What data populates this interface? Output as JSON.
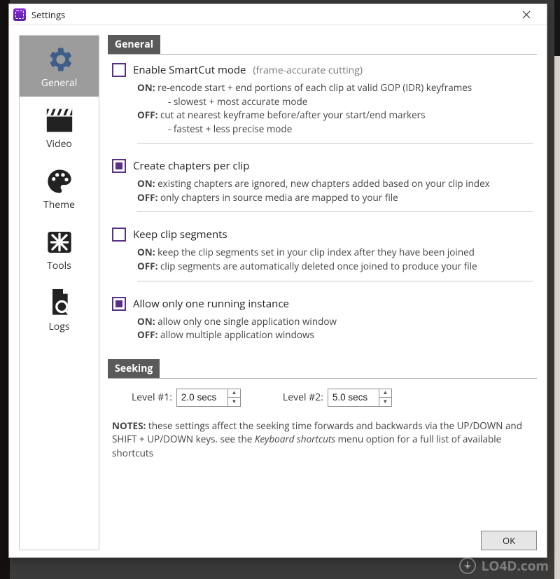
{
  "window": {
    "title": "Settings"
  },
  "sidebar": {
    "items": [
      {
        "label": "General"
      },
      {
        "label": "Video"
      },
      {
        "label": "Theme"
      },
      {
        "label": "Tools"
      },
      {
        "label": "Logs"
      }
    ]
  },
  "sections": {
    "general": {
      "header": "General",
      "options": {
        "smartcut": {
          "checked": false,
          "label": "Enable SmartCut mode",
          "paren": "(frame-accurate cutting)",
          "on_prefix": "ON:",
          "on_text": "re-encode start + end portions of each clip at valid GOP (IDR) keyframes",
          "on_sub": "- slowest + most accurate mode",
          "off_prefix": "OFF:",
          "off_text": "cut at nearest keyframe before/after your start/end markers",
          "off_sub": "- fastest + less precise mode"
        },
        "chapters": {
          "checked": true,
          "label": "Create chapters per clip",
          "on_prefix": "ON:",
          "on_text": "existing chapters are ignored, new chapters added based on your clip index",
          "off_prefix": "OFF:",
          "off_text": "only chapters in source media are mapped to your file"
        },
        "keep_segments": {
          "checked": false,
          "label": "Keep clip segments",
          "on_prefix": "ON:",
          "on_text": "keep the clip segments set in your clip index after they have been joined",
          "off_prefix": "OFF:",
          "off_text": "clip segments are automatically deleted once joined to produce your file"
        },
        "single_instance": {
          "checked": true,
          "label": "Allow only one running instance",
          "on_prefix": "ON:",
          "on_text": "allow only one single application window",
          "off_prefix": "OFF:",
          "off_text": "allow multiple application windows"
        }
      }
    },
    "seeking": {
      "header": "Seeking",
      "level1_label": "Level #1:",
      "level1_value": "2.0 secs",
      "level2_label": "Level #2:",
      "level2_value": "5.0 secs",
      "notes_prefix": "NOTES:",
      "notes_part1": "these settings affect the seeking time forwards and backwards via the UP/DOWN and SHIFT + UP/DOWN keys. see the ",
      "notes_italic": "Keyboard shortcuts",
      "notes_part2": " menu option for a full list of available shortcuts"
    }
  },
  "footer": {
    "ok_label": "OK"
  },
  "watermark": "LO4D.com"
}
